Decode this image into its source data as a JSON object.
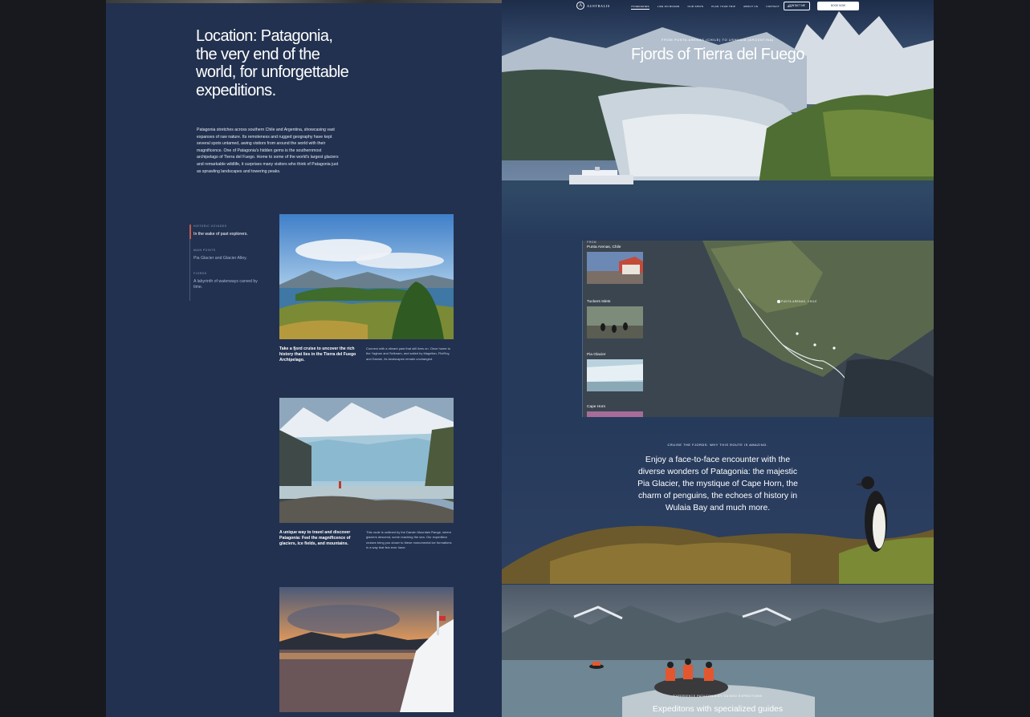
{
  "intro": {
    "title": "Location: Patagonia, the very end of the world, for unforgettable expeditions.",
    "body": "Patagonia stretches across southern Chile and Argentina, showcasing vast expanses of raw nature. Its remoteness and rugged geography have kept several spots untamed, awing visitors from around the world with their magnificence. One of Patagonia's hidden gems is the southernmost archipelago of Tierra del Fuego. Home to some of the world's largest glaciers and remarkable wildlife, it surprises many visitors who think of Patagonia just as sprawling landscapes and towering peaks."
  },
  "meta": [
    {
      "kicker": "Historic voyages",
      "value": "In the wake of past explorers."
    },
    {
      "kicker": "Main points",
      "value": "Pia Glacier and Glacier Alley."
    },
    {
      "kicker": "Fjords",
      "value": "A labyrinth of waterways carved by time."
    }
  ],
  "stories": [
    {
      "title": "Take a fjord cruise to uncover the rich history that lies in the Tierra del Fuego Archipelago.",
      "text": "Connect with a vibrant past that still lives on. Once home to the Yaghan and Selknam, and sailed by Magellan, FitzRoy, and Darwin, its landscapes remain unchanged."
    },
    {
      "title": "A unique way to travel and discover Patagonia: Feel the magnificence of glaciers, ice fields, and mountains.",
      "text": "This route is outlined by the Darwin Mountain Range, where glaciers descend, some reaching the sea. Our expedition cruises bring you closer to these monumental ice formations in a way that few ever have."
    }
  ],
  "nav": {
    "logo": "AUSTRALIS",
    "links": [
      "Itineraries",
      "Life on board",
      "Our ships",
      "Plan your trip",
      "About us",
      "Contact",
      "EN"
    ],
    "contact_button": "Contact me",
    "book_button": "Book now"
  },
  "hero": {
    "kicker": "From Punta Arenas (Chile) to Ushuaia (Argentina)",
    "title": "Fjords of Tierra del Fuego"
  },
  "route": {
    "map_label": "Punta Arenas, Chile",
    "stops": [
      {
        "kicker": "From",
        "name": "Punta Arenas, Chile"
      },
      {
        "kicker": "",
        "name": "Tuckers Islets"
      },
      {
        "kicker": "",
        "name": "Pia Glacier"
      },
      {
        "kicker": "",
        "name": "Cape Horn"
      }
    ]
  },
  "fjords": {
    "kicker": "Cruise the fjords: why this route is amazing.",
    "text": "Enjoy a face-to-face encounter with the diverse wonders of Patagonia: the majestic Pia Glacier, the mystique of Cape Horn, the charm of penguins, the echoes of history in Wulaia Bay and much more."
  },
  "expeditions": {
    "kicker": "Experience Patagonia by guided expeditions",
    "title": "Expeditons with specialized guides"
  }
}
